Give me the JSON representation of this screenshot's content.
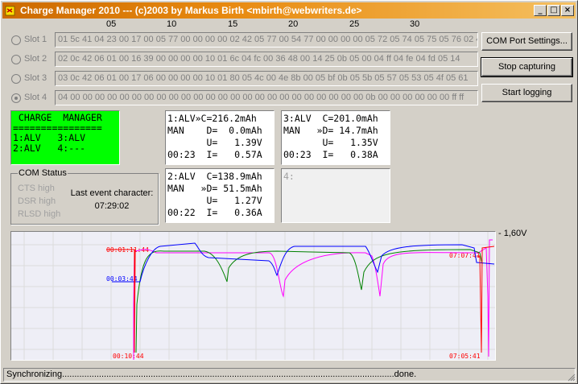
{
  "window": {
    "title": "Charge Manager 2010 --- (c)2003 by Markus Birth <mbirth@webwriters.de>",
    "title_color": "#cc6a00"
  },
  "ruler": [
    "05",
    "10",
    "15",
    "20",
    "25",
    "30"
  ],
  "slots": [
    {
      "label": "Slot 1",
      "checked": false,
      "data": "01 5c 41 04 23 00 17 00 05 77 00 00 00 00 02 42 05 77 00 54 77 00 00 00 00 05 72 05 74 05 75 05 76 02 42"
    },
    {
      "label": "Slot 2",
      "checked": false,
      "data": "02 0c 42 06 01 00 16 39 00 00 00 00 10 01 6c 04 fc 00 36 48 00 14 25 0b 05 00 04 ff 04 fe 04 fd 05 14"
    },
    {
      "label": "Slot 3",
      "checked": false,
      "data": "03 0c 42 06 01 00 17 06 00 00 00 00 10 01 80 05 4c 00 4e 8b 00 05 bf 0b 05 5b 05 57 05 53 05 4f 05 61"
    },
    {
      "label": "Slot 4",
      "checked": true,
      "data": "04 00 00 00 00 00 00 00 00 00 00 00 00 00 00 00 00 00 00 00 00 00 00 00 00 0b 00 00 00 00 00 00 ff ff"
    }
  ],
  "buttons": {
    "com_settings": "COM Port Settings...",
    "stop_capturing": "Stop capturing",
    "start_logging": "Start logging"
  },
  "lcd_main": " CHARGE  MANAGER\n================\n1:ALV   3:ALV\n2:ALV   4:---",
  "lcd_slots": [
    "1:ALV»C=216.2mAh\nMAN    D=  0.0mAh\n       U=   1.39V\n00:23  I=   0.57A",
    "3:ALV  C=201.0mAh\nMAN   »D= 14.7mAh\n       U=   1.35V\n00:23  I=   0.38A",
    "2:ALV  C=138.9mAh\nMAN   »D= 51.5mAh\n       U=   1.27V\n00:22  I=   0.36A",
    "4:"
  ],
  "com_status": {
    "title": "COM Status",
    "cts": "CTS high",
    "dsr": "DSR high",
    "rlsd": "RLSD high",
    "last_event_label": "Last event character:",
    "last_event_value": "07:29:02"
  },
  "chart_data": {
    "type": "line",
    "max_label": "- 1,60V",
    "time_labels": {
      "left_top_red": "00:01:11:44",
      "left_mid_blue": "00:03:44",
      "left_bottom_red": "00:10:44",
      "right_top_red": "07:07:41",
      "right_bottom_red": "07:05:41"
    },
    "series": [
      {
        "color": "#0000ff"
      },
      {
        "color": "#008000"
      },
      {
        "color": "#ff00ff"
      },
      {
        "color": "#ff0000"
      }
    ]
  },
  "statusbar": "Synchronizing.......................................................................................................................................done."
}
